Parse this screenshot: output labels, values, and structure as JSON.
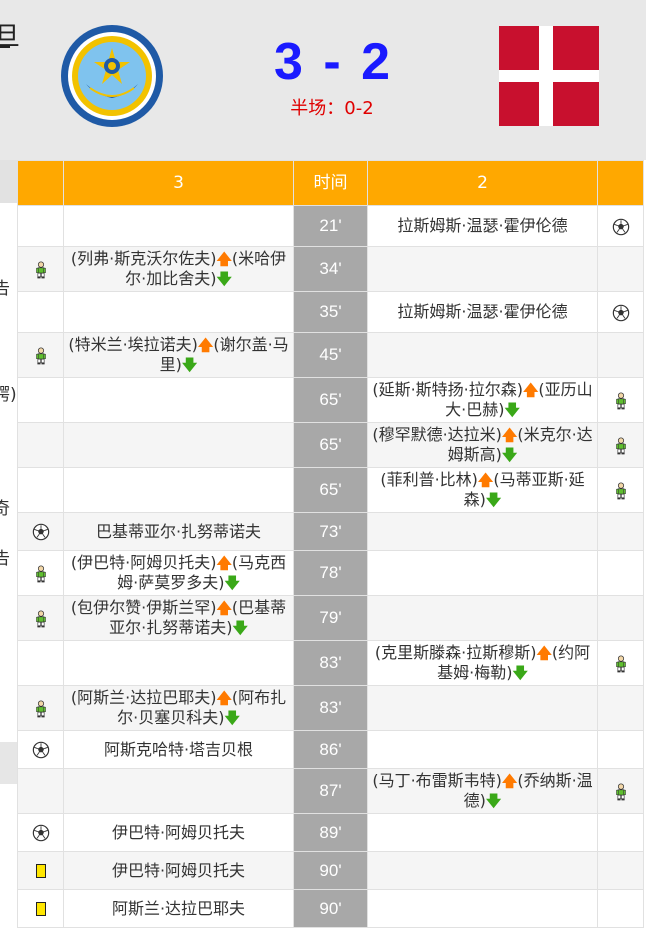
{
  "header": {
    "clipped_text": "旦",
    "score_home": "3",
    "score_sep": "-",
    "score_away": "2",
    "halftime": "半场：0-2"
  },
  "left_strip": {
    "chars": [
      "告",
      "锷)",
      ")",
      "奇",
      "告"
    ]
  },
  "table": {
    "columns": [
      "",
      "3",
      "时间",
      "2",
      ""
    ],
    "rows": [
      {
        "home_icon": "",
        "home_text": "",
        "time": "21'",
        "away_text": "拉斯姆斯·温瑟·霍伊伦德",
        "away_icon": "ball"
      },
      {
        "home_icon": "sub",
        "home_in": "(列弗·斯克沃尔佐夫)",
        "home_out": "(米哈伊尔·加比舍夫)",
        "time": "34'",
        "away_text": "",
        "away_icon": ""
      },
      {
        "home_icon": "",
        "home_text": "",
        "time": "35'",
        "away_text": "拉斯姆斯·温瑟·霍伊伦德",
        "away_icon": "ball"
      },
      {
        "home_icon": "sub",
        "home_in": "(特米兰·埃拉诺夫)",
        "home_out": "(谢尔盖·马里)",
        "time": "45'",
        "away_text": "",
        "away_icon": ""
      },
      {
        "home_icon": "",
        "home_text": "",
        "time": "65'",
        "away_in": "(延斯·斯特扬·拉尔森)",
        "away_out": "(亚历山大·巴赫)",
        "away_icon": "sub"
      },
      {
        "home_icon": "",
        "home_text": "",
        "time": "65'",
        "away_in": "(穆罕默德·达拉米)",
        "away_out": "(米克尔·达姆斯高)",
        "away_icon": "sub"
      },
      {
        "home_icon": "",
        "home_text": "",
        "time": "65'",
        "away_in": "(菲利普·比林)",
        "away_out": "(马蒂亚斯·延森)",
        "away_icon": "sub"
      },
      {
        "home_icon": "ball",
        "home_text": "巴基蒂亚尔·扎努蒂诺夫",
        "time": "73'",
        "away_text": "",
        "away_icon": ""
      },
      {
        "home_icon": "sub",
        "home_in": "(伊巴特·阿姆贝托夫)",
        "home_out": "(马克西姆·萨莫罗多夫)",
        "time": "78'",
        "away_text": "",
        "away_icon": ""
      },
      {
        "home_icon": "sub",
        "home_in": "(包伊尔赞·伊斯兰罕)",
        "home_out": "(巴基蒂亚尔·扎努蒂诺夫)",
        "time": "79'",
        "away_text": "",
        "away_icon": ""
      },
      {
        "home_icon": "",
        "home_text": "",
        "time": "83'",
        "away_in": "(克里斯滕森·拉斯穆斯)",
        "away_out": "(约阿基姆·梅勒)",
        "away_icon": "sub"
      },
      {
        "home_icon": "sub",
        "home_in": "(阿斯兰·达拉巴耶夫)",
        "home_out": "(阿布扎尔·贝塞贝科夫)",
        "time": "83'",
        "away_text": "",
        "away_icon": ""
      },
      {
        "home_icon": "ball",
        "home_text": "阿斯克哈特·塔吉贝根",
        "time": "86'",
        "away_text": "",
        "away_icon": ""
      },
      {
        "home_icon": "",
        "home_text": "",
        "time": "87'",
        "away_in": "(马丁·布雷斯韦特)",
        "away_out": "(乔纳斯·温德)",
        "away_icon": "sub"
      },
      {
        "home_icon": "ball",
        "home_text": "伊巴特·阿姆贝托夫",
        "time": "89'",
        "away_text": "",
        "away_icon": ""
      },
      {
        "home_icon": "yellow",
        "home_text": "伊巴特·阿姆贝托夫",
        "time": "90'",
        "away_text": "",
        "away_icon": ""
      },
      {
        "home_icon": "yellow",
        "home_text": "阿斯兰·达拉巴耶夫",
        "time": "90'",
        "away_text": "",
        "away_icon": ""
      }
    ]
  },
  "icons": {
    "goal": "soccer-ball-icon",
    "sub": "substitution-player-icon",
    "card": "yellow-card-icon",
    "in": "arrow-up-icon",
    "out": "arrow-down-icon"
  },
  "colors": {
    "header_orange": "#ffa800",
    "time_grey": "#a8a8a8",
    "score_blue": "#1a1aff",
    "halftime_red": "#e00000",
    "denmark_red": "#c8102e"
  }
}
